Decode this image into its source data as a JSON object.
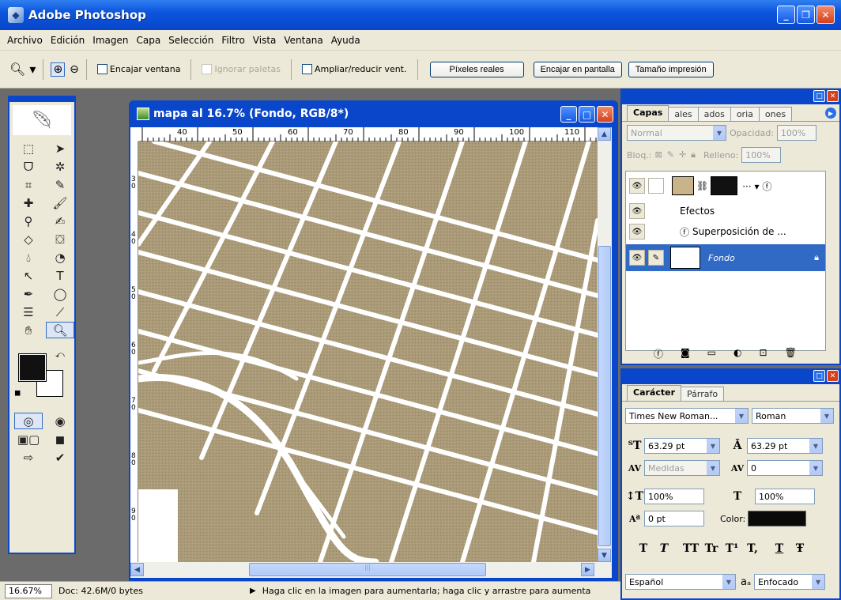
{
  "app": {
    "title": "Adobe Photoshop"
  },
  "menu": [
    "Archivo",
    "Edición",
    "Imagen",
    "Capa",
    "Selección",
    "Filtro",
    "Vista",
    "Ventana",
    "Ayuda"
  ],
  "options": {
    "encajar_ventana": "Encajar ventana",
    "ignorar_paletas": "Ignorar paletas",
    "ampliar": "Ampliar/reducir vent.",
    "pixeles_reales": "Píxeles reales",
    "encajar_pantalla": "Encajar en pantalla",
    "tamano_impresion": "Tamaño impresión"
  },
  "document": {
    "title": "mapa al 16.7% (Fondo, RGB/8*)",
    "ruler_top": [
      "40",
      "50",
      "60",
      "70",
      "80",
      "90",
      "100",
      "110"
    ],
    "ruler_left": [
      "3\n0",
      "4\n0",
      "5\n0",
      "6\n0",
      "7\n0",
      "8\n0",
      "9\n0"
    ]
  },
  "status": {
    "zoom": "16.67%",
    "doc": "Doc: 42.6M/0 bytes",
    "hint": "Haga clic en la imagen para aumentarla; haga clic y arrastre para aumenta"
  },
  "layers_panel": {
    "tabs": [
      "Capas",
      "ales",
      "ados",
      "oria",
      "ones"
    ],
    "blend_mode": "Normal",
    "opacity_label": "Opacidad:",
    "opacity": "100%",
    "lock_label": "Bloq.:",
    "fill_label": "Relleno:",
    "fill": "100%",
    "effects": "Efectos",
    "effect_item": "Superposición de ...",
    "background_layer": "Fondo"
  },
  "char_panel": {
    "tabs": [
      "Carácter",
      "Párrafo"
    ],
    "font": "Times New Roman...",
    "style": "Roman",
    "size": "63.29 pt",
    "leading": "63.29 pt",
    "kerning": "Medidas",
    "tracking": "0",
    "vscale": "100%",
    "hscale": "100%",
    "baseline": "0 pt",
    "color_label": "Color:",
    "type_buttons": [
      "T",
      "T",
      "TT",
      "Tr",
      "T¹",
      "T,",
      "T",
      "Ŧ"
    ],
    "language": "Español",
    "aa_label": "aₐ",
    "antialias": "Enfocado"
  }
}
